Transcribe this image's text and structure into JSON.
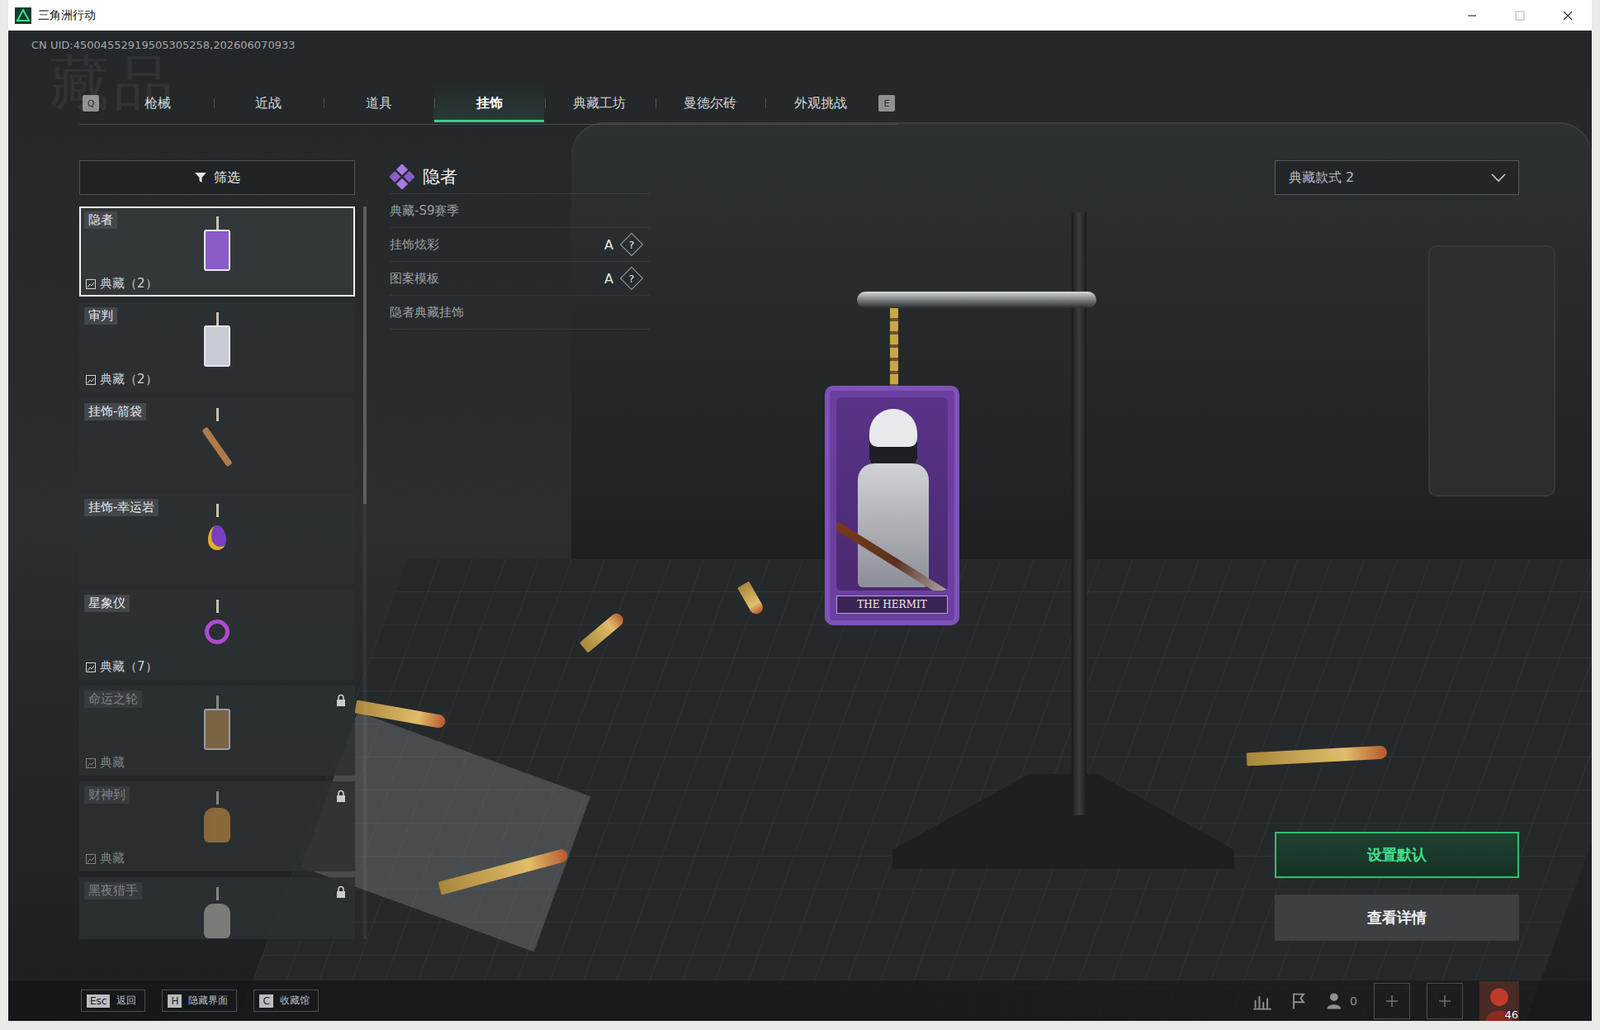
{
  "window": {
    "title": "三角洲行动"
  },
  "uid": "CN UID:45004552919505305258,202606070933",
  "watermark": "藏品",
  "tabs": {
    "prev_key": "Q",
    "next_key": "E",
    "items": [
      {
        "label": "枪械",
        "selected": false
      },
      {
        "label": "近战",
        "selected": false
      },
      {
        "label": "道具",
        "selected": false
      },
      {
        "label": "挂饰",
        "selected": true
      },
      {
        "label": "典藏工坊",
        "selected": false
      },
      {
        "label": "曼德尔砖",
        "selected": false
      },
      {
        "label": "外观挑战",
        "selected": false
      }
    ]
  },
  "filter": {
    "label": "筛选"
  },
  "items": [
    {
      "name": "隐者",
      "collection": "典藏（2）",
      "locked": false,
      "selected": true,
      "kind": "card",
      "color": "#8a5cc7"
    },
    {
      "name": "审判",
      "collection": "典藏（2）",
      "locked": false,
      "selected": false,
      "kind": "card",
      "color": "#c8ccd4"
    },
    {
      "name": "挂饰-箭袋",
      "collection": null,
      "locked": false,
      "selected": false,
      "kind": "stick",
      "color": "#b07a4a"
    },
    {
      "name": "挂饰-幸运岩",
      "collection": null,
      "locked": false,
      "selected": false,
      "kind": "gem",
      "color": "#7a3fc0"
    },
    {
      "name": "星象仪",
      "collection": "典藏（7）",
      "locked": false,
      "selected": false,
      "kind": "ring",
      "color": "#b04ad0"
    },
    {
      "name": "命运之轮",
      "collection": "典藏",
      "locked": true,
      "selected": false,
      "kind": "card",
      "color": "#b08a50"
    },
    {
      "name": "财神到",
      "collection": "典藏",
      "locked": true,
      "selected": false,
      "kind": "figure",
      "color": "#c89040"
    },
    {
      "name": "黑夜猎手",
      "collection": null,
      "locked": true,
      "selected": false,
      "kind": "figure",
      "color": "#b0b0a8"
    }
  ],
  "detail": {
    "title": "隐者",
    "rows": [
      {
        "label": "典藏-S9赛季",
        "grade": null,
        "help": null
      },
      {
        "label": "挂饰炫彩",
        "grade": "A",
        "help": "?"
      },
      {
        "label": "图案模板",
        "grade": "A",
        "help": "?"
      },
      {
        "label": "隐者典藏挂饰",
        "grade": null,
        "help": null
      }
    ]
  },
  "style_select": {
    "value": "典藏款式 2"
  },
  "buttons": [
    {
      "label": "设置默认",
      "primary": true
    },
    {
      "label": "查看详情",
      "primary": false
    }
  ],
  "charm": {
    "caption": "THE HERMIT"
  },
  "bottom": {
    "hints": [
      {
        "key": "Esc",
        "label": "返回"
      },
      {
        "key": "H",
        "label": "隐藏界面"
      },
      {
        "key": "C",
        "label": "收藏馆"
      }
    ],
    "friends_count": "0",
    "level": "46"
  }
}
